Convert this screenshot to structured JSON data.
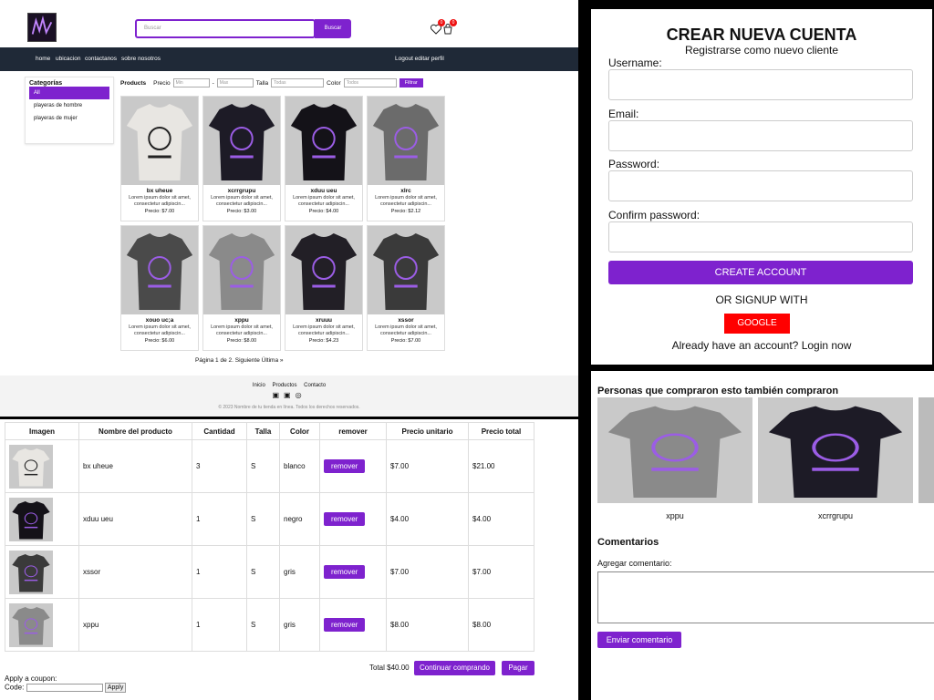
{
  "shop": {
    "search_placeholder": "Buscar",
    "search_button": "Buscar",
    "wishlist_count": "0",
    "cart_count": "0",
    "nav": [
      "home",
      "ubicacion",
      "contactanos",
      "sobre nosotros"
    ],
    "user_links": "Logout editar perfil",
    "categories_title": "Categorías",
    "categories": [
      "All",
      "playeras de hombre",
      "playeras de mujer"
    ],
    "filters": {
      "products_label": "Products",
      "price_label": "Precio",
      "min_placeholder": "Min",
      "max_placeholder": "Max",
      "size_label": "Talla",
      "size_value": "Todas",
      "color_label": "Color",
      "color_value": "Todos",
      "filter_button": "Filtrar"
    },
    "products": [
      {
        "name": "bx uheue",
        "desc": "Lorem ipsum dolor sit amet, consectetur adipiscin...",
        "price": "Precio: $7.00",
        "tone": "#e8e6e2"
      },
      {
        "name": "xcrrgrupu",
        "desc": "Lorem ipsum dolor sit amet, consectetur adipiscin...",
        "price": "Precio: $3.00",
        "tone": "#1d1b26"
      },
      {
        "name": "xduu ueu",
        "desc": "Lorem ipsum dolor sit amet, consectetur adipiscin...",
        "price": "Precio: $4.00",
        "tone": "#141218"
      },
      {
        "name": "xlrc",
        "desc": "Lorem ipsum dolor sit amet, consectetur adipiscin...",
        "price": "Precio: $2.12",
        "tone": "#6b6b6b"
      },
      {
        "name": "xouo uc;a",
        "desc": "Lorem ipsum dolor sit amet, consectetur adipiscin...",
        "price": "Precio: $6.00",
        "tone": "#4a4a4a"
      },
      {
        "name": "xppu",
        "desc": "Lorem ipsum dolor sit amet, consectetur adipiscin...",
        "price": "Precio: $8.00",
        "tone": "#8a8a8a"
      },
      {
        "name": "xruuu",
        "desc": "Lorem ipsum dolor sit amet, consectetur adipiscin...",
        "price": "Precio: $4.23",
        "tone": "#221f26"
      },
      {
        "name": "xssor",
        "desc": "Lorem ipsum dolor sit amet, consectetur adipiscin...",
        "price": "Precio: $7.00",
        "tone": "#3a3a3a"
      }
    ],
    "pager": "Página 1 de 2. Siguiente Última »",
    "footer_links": [
      "Inicio",
      "Productos",
      "Contacto"
    ],
    "footer_copy": "© 2023 Nombre de tu tienda en línea. Todos los derechos reservados."
  },
  "signup": {
    "title": "CREAR NUEVA CUENTA",
    "subtitle": "Registrarse como nuevo cliente",
    "username_label": "Username:",
    "email_label": "Email:",
    "password_label": "Password:",
    "confirm_label": "Confirm password:",
    "create_button": "CREATE ACCOUNT",
    "or_signup": "OR SIGNUP WITH",
    "google_button": "GOOGLE",
    "login_link": "Already have an account? Login now"
  },
  "cart": {
    "headers": [
      "Imagen",
      "Nombre del producto",
      "Cantidad",
      "Talla",
      "Color",
      "remover",
      "Precio unitario",
      "Precio total"
    ],
    "rows": [
      {
        "name": "bx uheue",
        "qty": "3",
        "size": "S",
        "color": "blanco",
        "remove": "remover",
        "unit": "$7.00",
        "total": "$21.00",
        "tone": "#e8e6e2"
      },
      {
        "name": "xduu ueu",
        "qty": "1",
        "size": "S",
        "color": "negro",
        "remove": "remover",
        "unit": "$4.00",
        "total": "$4.00",
        "tone": "#141218"
      },
      {
        "name": "xssor",
        "qty": "1",
        "size": "S",
        "color": "gris",
        "remove": "remover",
        "unit": "$7.00",
        "total": "$7.00",
        "tone": "#3a3a3a"
      },
      {
        "name": "xppu",
        "qty": "1",
        "size": "S",
        "color": "gris",
        "remove": "remover",
        "unit": "$8.00",
        "total": "$8.00",
        "tone": "#8a8a8a"
      }
    ],
    "total_label": "Total $40.00",
    "continue_button": "Continuar comprando",
    "pay_button": "Pagar",
    "coupon_label": "Apply a coupon:",
    "code_label": "Code:",
    "apply_button": "Apply"
  },
  "related": {
    "title": "Personas que compraron esto también compraron",
    "items": [
      {
        "name": "xppu",
        "tone": "#8a8a8a"
      },
      {
        "name": "xcrrgrupu",
        "tone": "#1d1b26"
      }
    ],
    "comments_title": "Comentarios",
    "add_comment_label": "Agregar comentario:",
    "send_button": "Enviar comentario"
  },
  "colors": {
    "accent": "#7e22ce",
    "nav_bg": "#1f2937",
    "google": "#ff0000"
  }
}
